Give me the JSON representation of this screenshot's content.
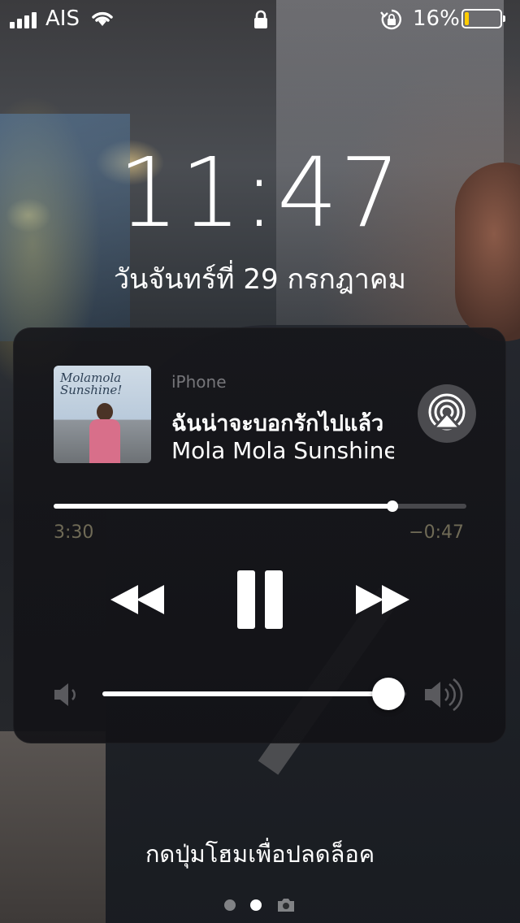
{
  "status_bar": {
    "carrier": "AIS",
    "battery_percent": "16%",
    "battery_level": 0.16,
    "signal_bars": 4,
    "icons": [
      "signal-icon",
      "wifi-icon",
      "lock-icon",
      "rotation-lock-icon",
      "battery-icon"
    ]
  },
  "lock_screen": {
    "time": "11:47",
    "date": "วันจันทร์ที่ 29 กรกฎาคม",
    "unlock_hint": "กดปุ่มโฮมเพื่อปลดล็อค"
  },
  "now_playing": {
    "source": "iPhone",
    "title": "ฉันน่าจะบอกรักไปแล้ว",
    "artist": "Mola Mola Sunshine",
    "album_cover_text": "Molamola Sunshine!",
    "elapsed": "3:30",
    "remaining": "−0:47",
    "progress": 0.82,
    "volume": 0.94
  },
  "pager": {
    "pages": 2,
    "current": 2,
    "camera_icon": "camera-icon"
  },
  "colors": {
    "battery_fill": "#ffcc00",
    "card_bg": "#161619"
  }
}
